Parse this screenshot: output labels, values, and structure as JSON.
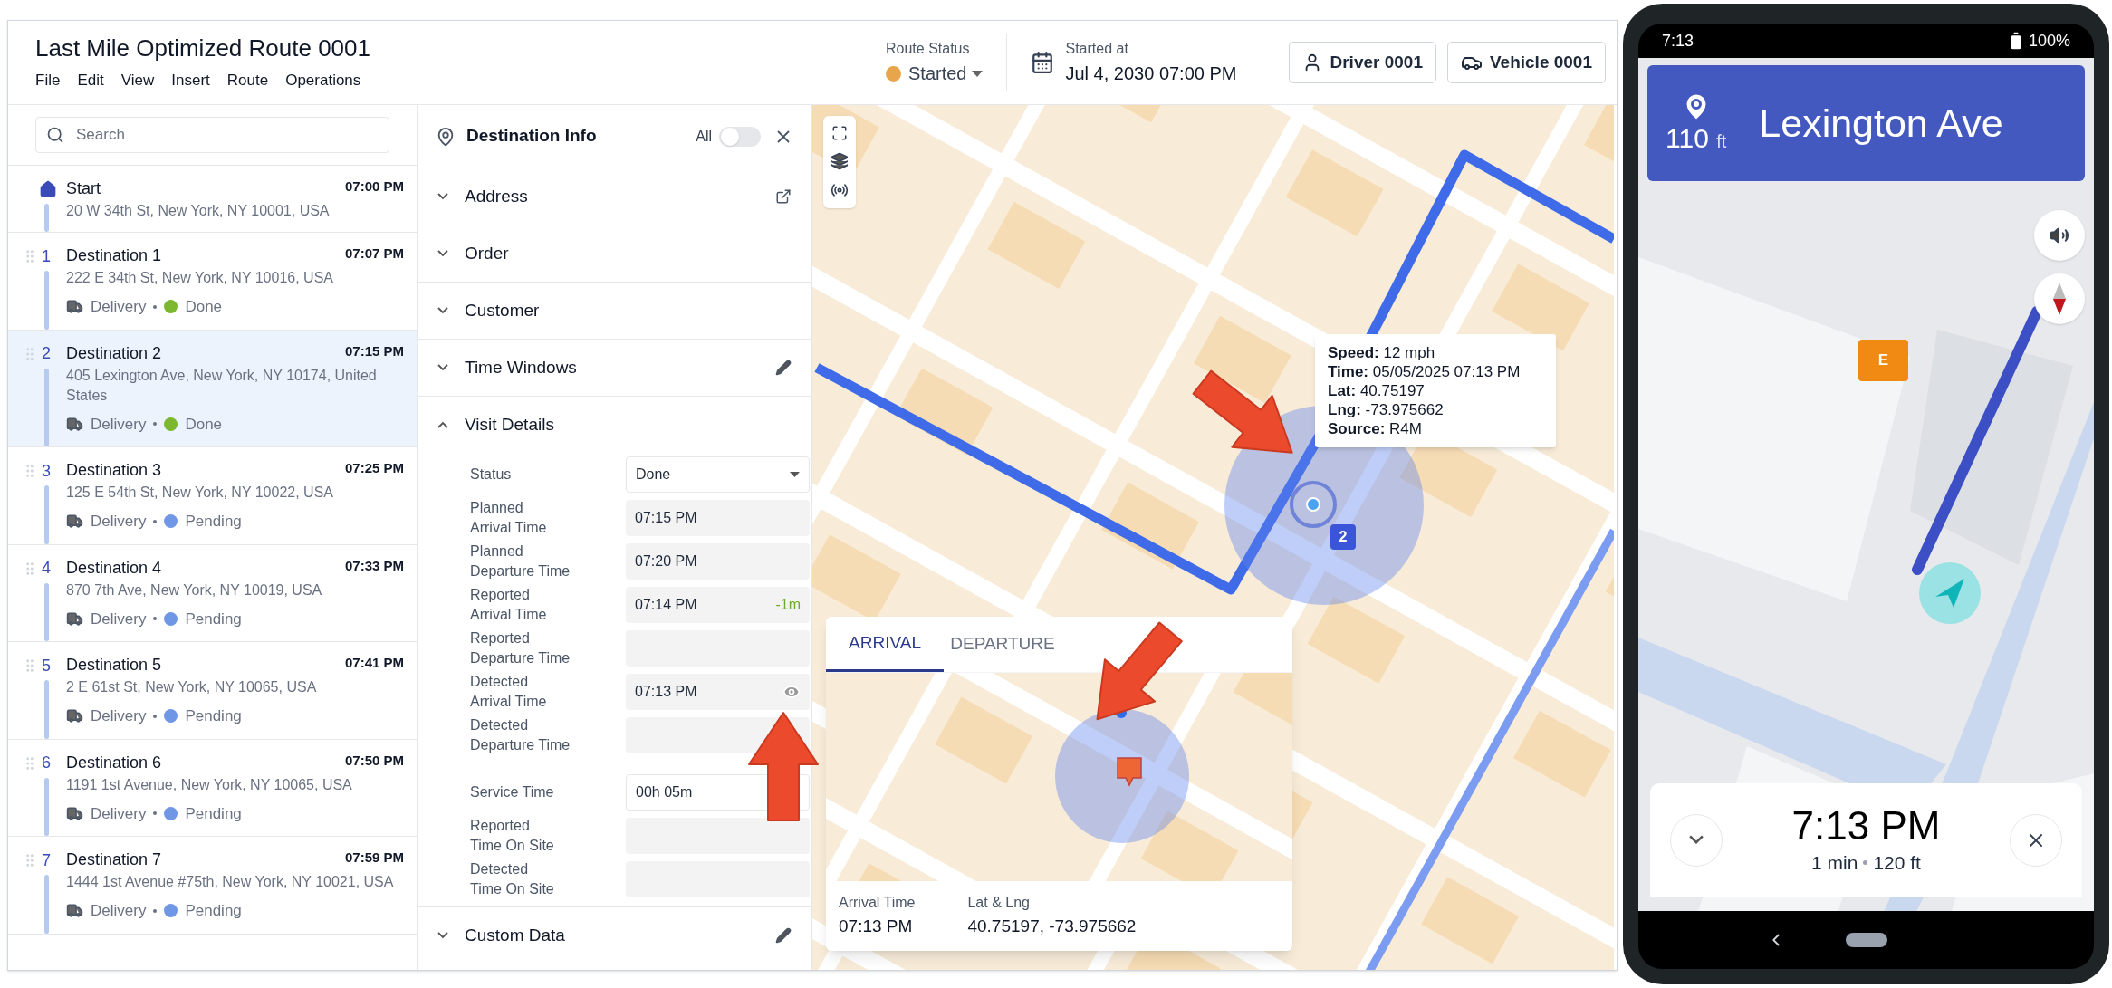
{
  "app": {
    "title": "Last Mile Optimized Route 0001",
    "menu": [
      "File",
      "Edit",
      "View",
      "Insert",
      "Route",
      "Operations"
    ]
  },
  "route_status": {
    "label": "Route Status",
    "value": "Started",
    "color": "#e8a54b"
  },
  "started_at": {
    "label": "Started at",
    "value": "Jul 4, 2030 07:00 PM"
  },
  "buttons": [
    {
      "kind": "driver",
      "label": "Driver 0001"
    },
    {
      "kind": "vehicle",
      "label": "Vehicle 0001"
    }
  ],
  "sidebar": {
    "search": {
      "placeholder": "Search"
    },
    "stops": [
      {
        "kind": "start",
        "name": "Start",
        "time": "07:00 PM",
        "address": "20 W 34th St, New York, NY 10001, USA",
        "selected": false
      },
      {
        "kind": "destination",
        "number": "1",
        "name": "Destination 1",
        "time": "07:07 PM",
        "address": "222 E 34th St, New York, NY 10016, USA",
        "type": "Delivery",
        "status": "Done",
        "color": "#7cb82f",
        "selected": false
      },
      {
        "kind": "destination",
        "number": "2",
        "name": "Destination 2",
        "time": "07:15 PM",
        "address": "405 Lexington Ave, New York, NY 10174, United States",
        "type": "Delivery",
        "status": "Done",
        "color": "#7cb82f",
        "selected": true
      },
      {
        "kind": "destination",
        "number": "3",
        "name": "Destination 3",
        "time": "07:25 PM",
        "address": "125 E 54th St, New York, NY 10022, USA",
        "type": "Delivery",
        "status": "Pending",
        "color": "#6f97e6",
        "selected": false
      },
      {
        "kind": "destination",
        "number": "4",
        "name": "Destination 4",
        "time": "07:33 PM",
        "address": "870 7th Ave, New York, NY 10019, USA",
        "type": "Delivery",
        "status": "Pending",
        "color": "#6f97e6",
        "selected": false
      },
      {
        "kind": "destination",
        "number": "5",
        "name": "Destination 5",
        "time": "07:41 PM",
        "address": "2 E 61st St, New York, NY 10065, USA",
        "type": "Delivery",
        "status": "Pending",
        "color": "#6f97e6",
        "selected": false
      },
      {
        "kind": "destination",
        "number": "6",
        "name": "Destination 6",
        "time": "07:50 PM",
        "address": "1191 1st Avenue, New York, NY 10065, USA",
        "type": "Delivery",
        "status": "Pending",
        "color": "#6f97e6",
        "selected": false
      },
      {
        "kind": "destination",
        "number": "7",
        "name": "Destination 7",
        "time": "07:59 PM",
        "address": "1444 1st Avenue #75th, New York, NY 10021, USA",
        "type": "Delivery",
        "status": "Pending",
        "color": "#6f97e6",
        "selected": false
      }
    ]
  },
  "destination_info": {
    "title": "Destination Info",
    "toggle": {
      "label": "All",
      "on": false
    },
    "sections": [
      {
        "title": "Address",
        "expanded": false,
        "external_link": true
      },
      {
        "title": "Order",
        "expanded": false
      },
      {
        "title": "Customer",
        "expanded": false
      },
      {
        "title": "Time Windows",
        "expanded": false,
        "editable": true
      },
      {
        "title": "Visit Details",
        "expanded": true,
        "groups": [
          [
            {
              "label": [
                "Status"
              ],
              "kind": "select",
              "value": "Done"
            },
            {
              "label": [
                "Planned",
                "Arrival Time"
              ],
              "kind": "readonly",
              "value": "07:15 PM"
            },
            {
              "label": [
                "Planned",
                "Departure Time"
              ],
              "kind": "readonly",
              "value": "07:20 PM"
            },
            {
              "label": [
                "Reported",
                "Arrival Time"
              ],
              "kind": "readonly",
              "value": "07:14 PM",
              "delta": "-1m"
            },
            {
              "label": [
                "Reported",
                "Departure Time"
              ],
              "kind": "readonly"
            },
            {
              "label": [
                "Detected",
                "Arrival Time"
              ],
              "kind": "readonly",
              "value": "07:13 PM",
              "viewable": true
            },
            {
              "label": [
                "Detected",
                "Departure Time"
              ],
              "kind": "readonly"
            }
          ],
          [
            {
              "label": [
                "Service Time"
              ],
              "kind": "input",
              "value": "00h 05m"
            },
            {
              "label": [
                "Reported",
                "Time On Site"
              ],
              "kind": "readonly"
            },
            {
              "label": [
                "Detected",
                "Time On Site"
              ],
              "kind": "readonly"
            }
          ]
        ]
      },
      {
        "title": "Custom Data",
        "expanded": false,
        "editable": true
      }
    ]
  },
  "map": {
    "marker_number": "2",
    "tooltip": [
      {
        "label": "Speed:",
        "value": "12 mph"
      },
      {
        "label": "Time:",
        "value": "05/05/2025 07:13 PM"
      },
      {
        "label": "Lat:",
        "value": "40.75197"
      },
      {
        "label": "Lng:",
        "value": "-73.975662"
      },
      {
        "label": "Source:",
        "value": "R4M"
      }
    ],
    "popup": {
      "tabs": [
        {
          "label": "ARRIVAL",
          "selected": true
        },
        {
          "label": "DEPARTURE",
          "selected": false
        }
      ],
      "fields": [
        {
          "label": "Arrival Time",
          "value": "07:13 PM"
        },
        {
          "label": "Lat & Lng",
          "value": "40.75197, -73.975662"
        }
      ]
    }
  },
  "phone": {
    "time": "7:13",
    "battery": "100%",
    "banner": {
      "distance": "110",
      "unit": "ft",
      "street": "Lexington Ave"
    },
    "marker": "E",
    "sheet": {
      "eta": "7:13 PM",
      "duration": "1 min",
      "distance": "120 ft"
    }
  }
}
